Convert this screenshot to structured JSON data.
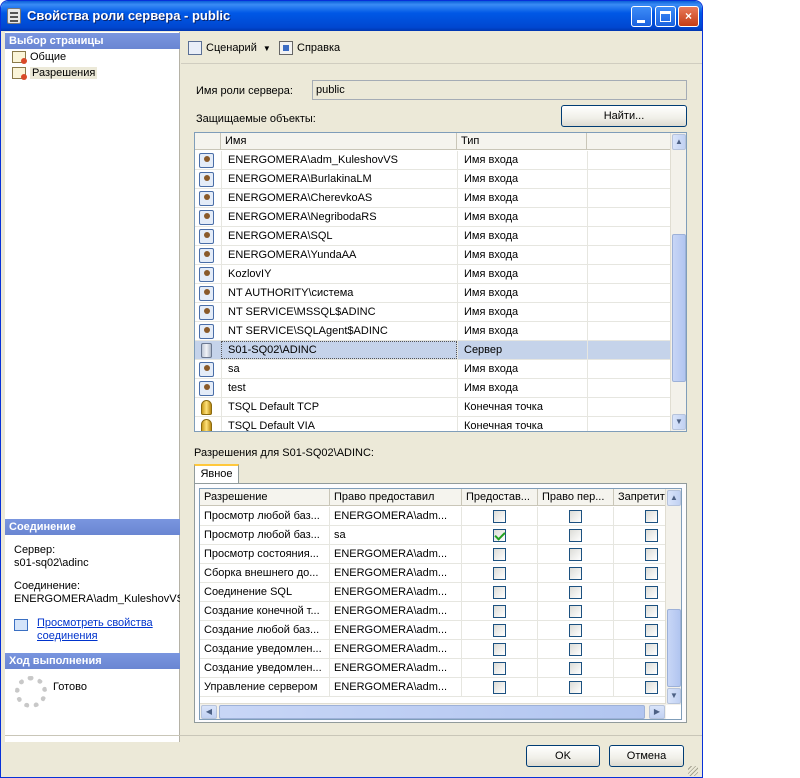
{
  "window": {
    "title": "Свойства роли сервера - public",
    "controls": {
      "minimize": "minimize",
      "maximize": "maximize",
      "close": "×"
    }
  },
  "left_pane": {
    "select_page_header": "Выбор страницы",
    "pages": [
      {
        "label": "Общие",
        "selected": false
      },
      {
        "label": "Разрешения",
        "selected": true
      }
    ],
    "connection_header": "Соединение",
    "server_label": "Сервер:",
    "server_value": "s01-sq02\\adinc",
    "connection_label": "Соединение:",
    "connection_value": "ENERGOMERA\\adm_KuleshovVS",
    "view_connection_link_line1": "Просмотреть свойства",
    "view_connection_link_line2": "соединения",
    "progress_header": "Ход выполнения",
    "progress_status": "Готово"
  },
  "toolbar": {
    "script_label": "Сценарий",
    "help_label": "Справка"
  },
  "main": {
    "role_name_label": "Имя роли сервера:",
    "role_name_value": "public",
    "find_button": "Найти...",
    "securables_label": "Защищаемые объекты:",
    "securables_columns": [
      "Имя",
      "Тип"
    ],
    "securables": [
      {
        "icon": "login",
        "name": "ENERGOMERA\\adm_KuleshovVS",
        "type": "Имя входа"
      },
      {
        "icon": "login",
        "name": "ENERGOMERA\\BurlakinaLM",
        "type": "Имя входа"
      },
      {
        "icon": "login",
        "name": "ENERGOMERA\\CherevkoAS",
        "type": "Имя входа"
      },
      {
        "icon": "login",
        "name": "ENERGOMERA\\NegribodaRS",
        "type": "Имя входа"
      },
      {
        "icon": "login",
        "name": "ENERGOMERA\\SQL",
        "type": "Имя входа"
      },
      {
        "icon": "login",
        "name": "ENERGOMERA\\YundaAA",
        "type": "Имя входа"
      },
      {
        "icon": "login",
        "name": "KozlovIY",
        "type": "Имя входа"
      },
      {
        "icon": "login",
        "name": "NT AUTHORITY\\система",
        "type": "Имя входа"
      },
      {
        "icon": "login",
        "name": "NT SERVICE\\MSSQL$ADINC",
        "type": "Имя входа"
      },
      {
        "icon": "login",
        "name": "NT SERVICE\\SQLAgent$ADINC",
        "type": "Имя входа"
      },
      {
        "icon": "server",
        "name": "S01-SQ02\\ADINC",
        "type": "Сервер",
        "selected": true
      },
      {
        "icon": "login",
        "name": "sa",
        "type": "Имя входа"
      },
      {
        "icon": "login",
        "name": "test",
        "type": "Имя входа"
      },
      {
        "icon": "endpoint",
        "name": "TSQL Default TCP",
        "type": "Конечная точка"
      },
      {
        "icon": "endpoint",
        "name": "TSQL Default VIA",
        "type": "Конечная точка"
      }
    ],
    "permissions_label": "Разрешения для S01-SQ02\\ADINC:",
    "tab_label": "Явное",
    "permissions_columns": [
      "Разрешение",
      "Право предоставил",
      "Предостав...",
      "Право пер...",
      "Запретить"
    ],
    "permissions": [
      {
        "permission": "Просмотр любой баз...",
        "grantor": "ENERGOMERA\\adm...",
        "grant": false,
        "with_grant": false,
        "deny": false
      },
      {
        "permission": "Просмотр любой баз...",
        "grantor": "sa",
        "grant": true,
        "with_grant": false,
        "deny": false
      },
      {
        "permission": "Просмотр состояния...",
        "grantor": "ENERGOMERA\\adm...",
        "grant": false,
        "with_grant": false,
        "deny": false
      },
      {
        "permission": "Сборка внешнего до...",
        "grantor": "ENERGOMERA\\adm...",
        "grant": false,
        "with_grant": false,
        "deny": false
      },
      {
        "permission": "Соединение SQL",
        "grantor": "ENERGOMERA\\adm...",
        "grant": false,
        "with_grant": false,
        "deny": false
      },
      {
        "permission": "Создание конечной т...",
        "grantor": "ENERGOMERA\\adm...",
        "grant": false,
        "with_grant": false,
        "deny": false
      },
      {
        "permission": "Создание любой баз...",
        "grantor": "ENERGOMERA\\adm...",
        "grant": false,
        "with_grant": false,
        "deny": false
      },
      {
        "permission": "Создание уведомлен...",
        "grantor": "ENERGOMERA\\adm...",
        "grant": false,
        "with_grant": false,
        "deny": false
      },
      {
        "permission": "Создание уведомлен...",
        "grantor": "ENERGOMERA\\adm...",
        "grant": false,
        "with_grant": false,
        "deny": false
      },
      {
        "permission": "Управление сервером",
        "grantor": "ENERGOMERA\\adm...",
        "grant": false,
        "with_grant": false,
        "deny": false
      }
    ]
  },
  "footer": {
    "ok_button": "OK",
    "cancel_button": "Отмена"
  },
  "colors": {
    "title_bar": "#0058e6",
    "pane_header": "#7a96df",
    "selection": "#c5d3ea",
    "window_face": "#ece9d8"
  }
}
